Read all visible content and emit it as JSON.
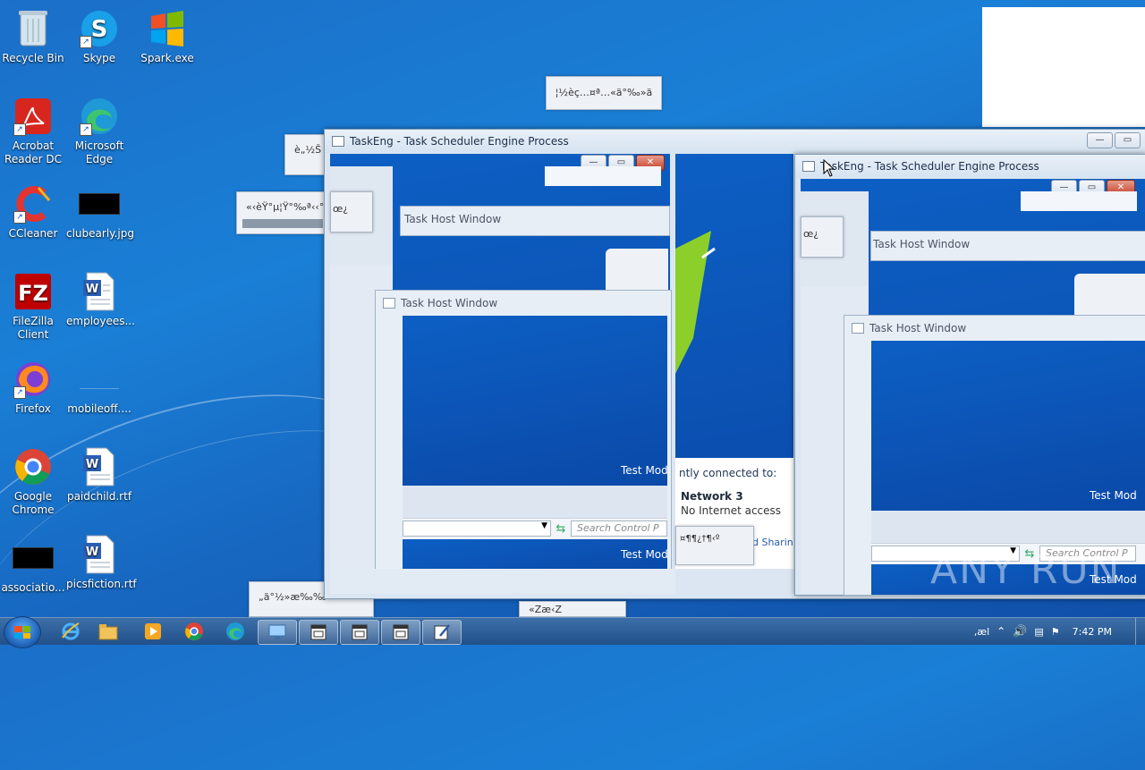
{
  "desktop": {
    "icons": [
      {
        "label": "Recycle Bin"
      },
      {
        "label": "Skype"
      },
      {
        "label": "Spark.exe"
      },
      {
        "label": "Acrobat Reader DC"
      },
      {
        "label": "Microsoft Edge"
      },
      {
        "label": "CCleaner"
      },
      {
        "label": "clubearly.jpg"
      },
      {
        "label": "FileZilla Client"
      },
      {
        "label": "employees..."
      },
      {
        "label": "Firefox"
      },
      {
        "label": "mobileoff...."
      },
      {
        "label": "Google Chrome"
      },
      {
        "label": "paidchild.rtf"
      },
      {
        "label": "associatio..."
      },
      {
        "label": "picsfiction.rtf"
      }
    ],
    "watermark": "ANY RUN"
  },
  "popups": {
    "p1": "¦½èç…¤ª…«ä°‰»ä",
    "p2": "è„½Š",
    "p3": "«‹èŸ°µ¦Ÿ°‰ª‹‹°",
    "p4": "œ¿",
    "p5": "„ä°½»æ‰‰«",
    "p6": "«Zæ‹Z"
  },
  "window1": {
    "title": "TaskEng - Task Scheduler Engine Process",
    "task_host_1": "Task Host Window",
    "task_host_2": "Task Host Window",
    "search_placeholder": "Search Control P",
    "test_mode_1": "Test Mod",
    "test_mode_2": "Test Mod",
    "network_intro": "ntly connected to:",
    "network_name": "Network  3",
    "network_status": "No Internet access",
    "sharing": "d Sharin",
    "popup_text": "¤¶¶¿†¶‹º"
  },
  "window2": {
    "title": "TaskEng - Task Scheduler Engine Process",
    "task_host_1": "Task Host Window",
    "task_host_2": "Task Host Window",
    "search_placeholder": "Search Control P",
    "test_mode_1": "Test Mod",
    "test_mode_2": "Test Mod",
    "popup_text": "œ¿"
  },
  "taskbar": {
    "clock": "7:42 PM",
    "tray_lang": "‚æl",
    "items": [
      "ie-icon",
      "explorer-icon",
      "media-player-icon",
      "chrome-icon",
      "edge-icon",
      "taskeng-icon",
      "taskeng-icon",
      "taskeng-icon",
      "wordpad-icon"
    ]
  }
}
